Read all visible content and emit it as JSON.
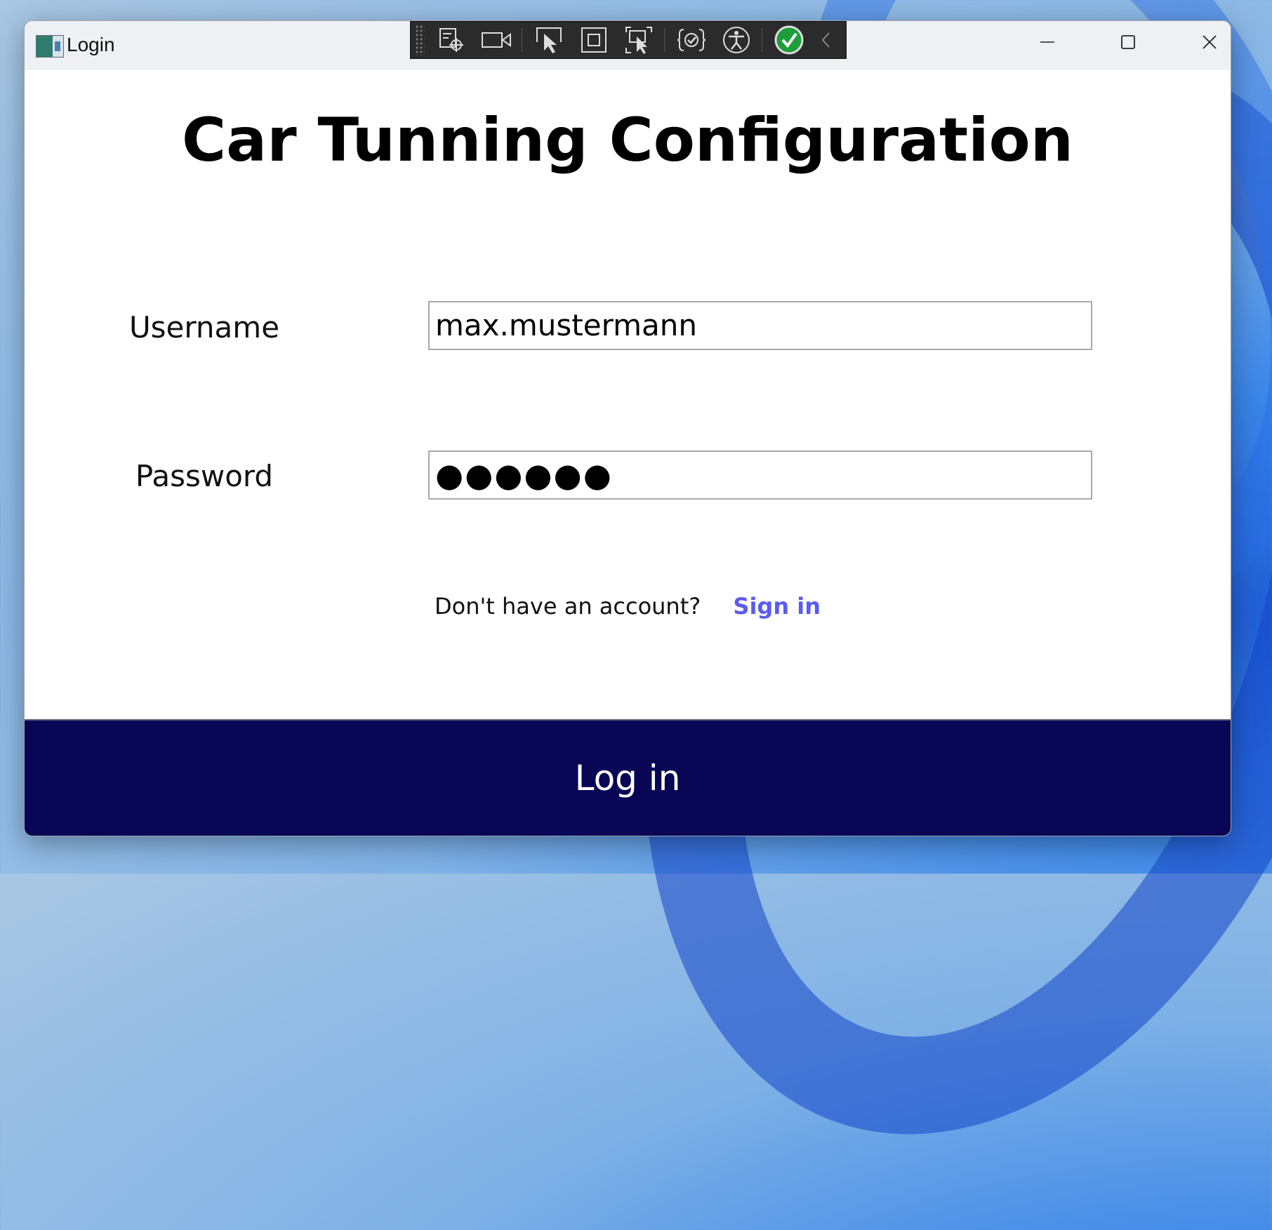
{
  "window": {
    "title": "Login",
    "controls": {
      "minimize": "minimize-icon",
      "maximize": "maximize-icon",
      "close": "close-icon"
    }
  },
  "dev_toolbar": {
    "icons": [
      "live-visual-tree-icon",
      "record-icon",
      "select-element-icon",
      "display-layout-adorners-icon",
      "track-focus-icon",
      "binding-failures-icon",
      "accessibility-icon",
      "hot-reload-ok-icon",
      "collapse-chevron-icon"
    ]
  },
  "main": {
    "heading": "Car Tunning Configuration",
    "username_label": "Username",
    "username_value": "max.mustermann",
    "password_label": "Password",
    "password_value": "●●●●●●",
    "no_account_text": "Don't have an account?",
    "sign_in_link": "Sign in",
    "login_button": "Log in"
  },
  "colors": {
    "login_button_bg": "#090755",
    "link": "#5b5bf0",
    "hot_reload_ok": "#1e9e3a"
  }
}
